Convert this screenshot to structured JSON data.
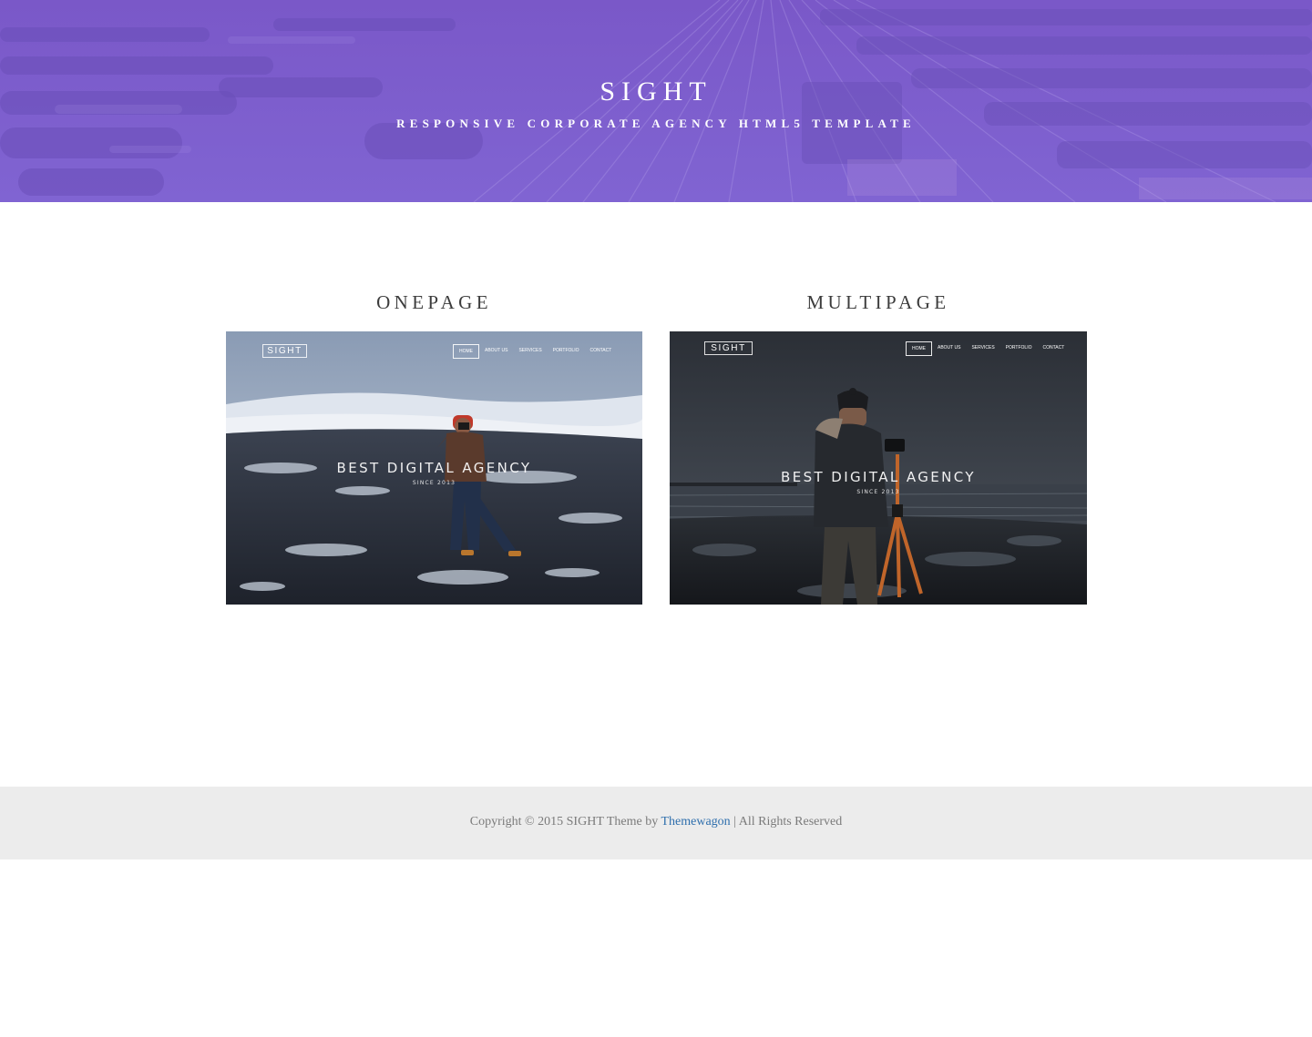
{
  "colors": {
    "hero_overlay": "#7b5fd0",
    "heading_text": "#3c3c3c",
    "footer_bg": "#ececec",
    "footer_text": "#7a7a7a",
    "link": "#2f6fad"
  },
  "hero": {
    "title": "SIGHT",
    "subtitle": "RESPONSIVE CORPORATE AGENCY HTML5 TEMPLATE"
  },
  "demos": [
    {
      "heading": "ONEPAGE",
      "preview": {
        "logo": "SIGHT",
        "menu": [
          "HOME",
          "ABOUT US",
          "SERVICES",
          "PORTFOLIO",
          "CONTACT"
        ],
        "active_menu": "HOME",
        "tagline": "BEST DIGITAL AGENCY",
        "since": "SINCE 2013"
      }
    },
    {
      "heading": "MULTIPAGE",
      "preview": {
        "logo": "SIGHT",
        "menu": [
          "HOME",
          "ABOUT US",
          "SERVICES",
          "PORTFOLIO",
          "CONTACT"
        ],
        "active_menu": "HOME",
        "tagline": "BEST DIGITAL AGENCY",
        "since": "SINCE 2013"
      }
    }
  ],
  "footer": {
    "prefix": "Copyright © 2015 SIGHT Theme by",
    "link_text": "Themewagon",
    "suffix": "| All Rights Reserved"
  }
}
